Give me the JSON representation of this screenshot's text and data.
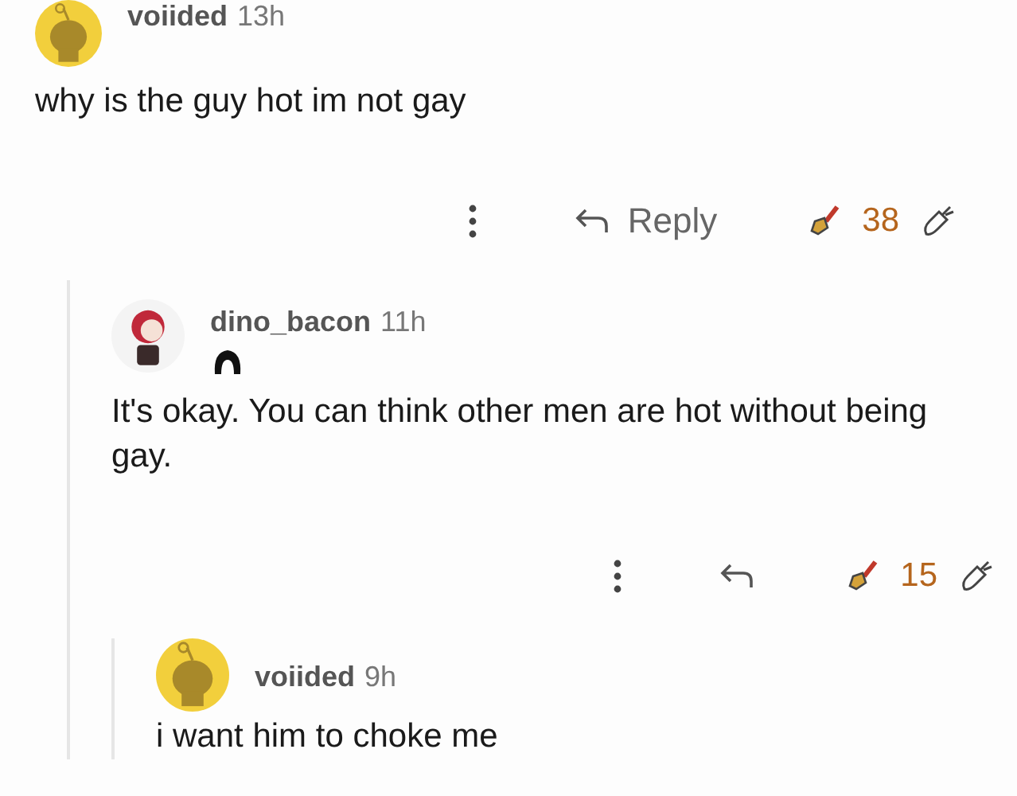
{
  "comments": [
    {
      "avatar": {
        "kind": "snoo"
      },
      "user": "voiided",
      "time": "13h",
      "flair": false,
      "body": "why is the guy hot im not gay",
      "actions": {
        "reply_label": "Reply",
        "score": "38",
        "upvoted": true
      },
      "children": [
        {
          "avatar": {
            "kind": "character"
          },
          "user": "dino_bacon",
          "time": "11h",
          "flair": true,
          "body": "It's okay. You can think other men are hot without being gay.",
          "actions": {
            "score": "15",
            "upvoted": true
          },
          "children": [
            {
              "avatar": {
                "kind": "snoo"
              },
              "user": "voiided",
              "time": "9h",
              "flair": false,
              "body": "i want him to choke me"
            }
          ]
        }
      ]
    }
  ]
}
